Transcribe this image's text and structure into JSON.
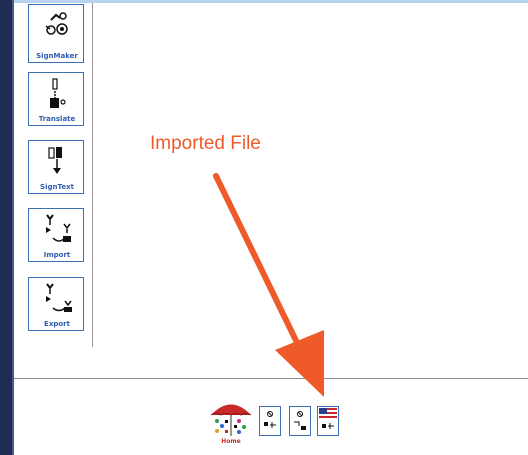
{
  "toolbar": {
    "items": [
      {
        "label": "SignMaker",
        "icon": "signmaker-icon"
      },
      {
        "label": "Translate",
        "icon": "translate-icon"
      },
      {
        "label": "SignText",
        "icon": "signtext-icon"
      },
      {
        "label": "Import",
        "icon": "import-icon"
      },
      {
        "label": "Export",
        "icon": "export-icon"
      }
    ]
  },
  "annotation": {
    "text": "Imported File",
    "color": "#ef5a2a"
  },
  "bottom_bar": {
    "home_label": "Home",
    "files": [
      {
        "icon": "sign-document-icon"
      },
      {
        "icon": "sign-document-icon"
      },
      {
        "icon": "us-flag-document-icon"
      }
    ]
  },
  "colors": {
    "frame": "#1f2c54",
    "accent": "#3d6fb5",
    "top_bar": "#b9d3ee"
  }
}
